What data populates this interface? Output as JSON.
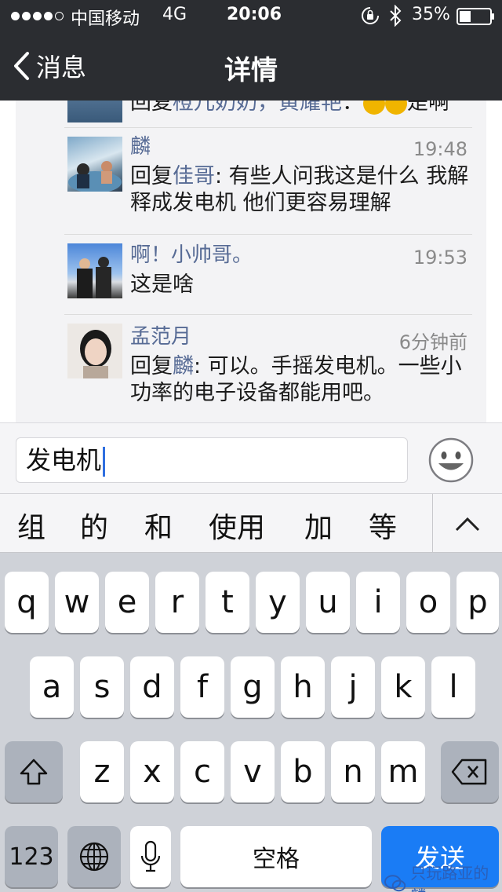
{
  "status_bar": {
    "carrier": "中国移动",
    "network": "4G",
    "time": "20:06",
    "battery": "35%"
  },
  "nav": {
    "back_label": "消息",
    "title": "详情"
  },
  "comments": [
    {
      "name": "",
      "time": "",
      "text_prefix": "回复",
      "mention": "橙儿奶奶，黄耀艳",
      "text": "：",
      "trailing": "是啊"
    },
    {
      "name": "麟",
      "time": "19:48",
      "text_prefix": "回复",
      "mention": "佳哥",
      "text": ": 有些人问我这是什么 我解释成发电机 他们更容易理解"
    },
    {
      "name": "啊！小帅哥。",
      "time": "19:53",
      "text_prefix": "",
      "mention": "",
      "text": "这是啥"
    },
    {
      "name": "孟范月",
      "time": "6分钟前",
      "text_prefix": "回复",
      "mention": "麟",
      "text": ": 可以。手摇发电机。一些小功率的电子设备都能用吧。"
    }
  ],
  "input": {
    "value": "发电机"
  },
  "candidates": [
    "组",
    "的",
    "和",
    "使用",
    "加",
    "等"
  ],
  "keyboard": {
    "row1": [
      "q",
      "w",
      "e",
      "r",
      "t",
      "y",
      "u",
      "i",
      "o",
      "p"
    ],
    "row2": [
      "a",
      "s",
      "d",
      "f",
      "g",
      "h",
      "j",
      "k",
      "l"
    ],
    "row3": [
      "z",
      "x",
      "c",
      "v",
      "b",
      "n",
      "m"
    ],
    "numbers_label": "123",
    "space_label": "空格",
    "send_label": "发送"
  },
  "watermark": "只玩路亚的麟",
  "icons": {
    "back": "chevron-left-icon",
    "orientation_lock": "orientation-lock-icon",
    "bluetooth": "bluetooth-icon",
    "battery": "battery-icon",
    "emoji": "smiley-icon",
    "collapse": "chevron-up-icon",
    "shift": "shift-icon",
    "delete": "backspace-icon",
    "globe": "globe-icon",
    "mic": "microphone-icon"
  },
  "colors": {
    "nav_bar": "#2b2d31",
    "link": "#576b95",
    "send_key": "#1a7cf5"
  }
}
